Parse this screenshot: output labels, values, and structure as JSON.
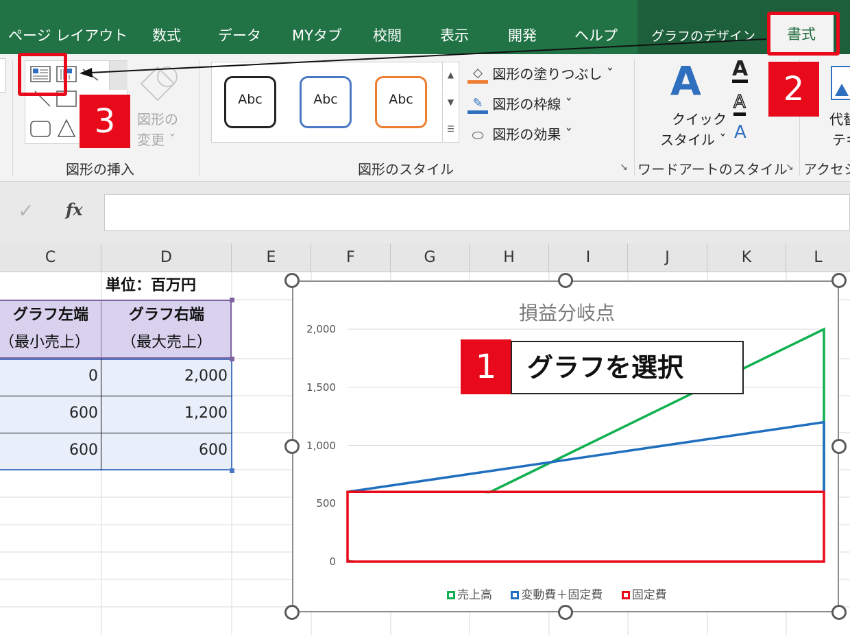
{
  "tabs": [
    "ページ レイアウト",
    "数式",
    "データ",
    "MYタブ",
    "校閲",
    "表示",
    "開発",
    "ヘルプ",
    "グラフのデザイン",
    "書式"
  ],
  "ribbon": {
    "insert_shapes_group": "図形の挿入",
    "change_shape": [
      "図形の",
      "変更 ˇ"
    ],
    "shape_styles_group": "図形のスタイル",
    "style_thumbs": [
      "Abc",
      "Abc",
      "Abc"
    ],
    "fill": "図形の塗りつぶし ˇ",
    "outline": "図形の枠線 ˇ",
    "effects": "図形の効果 ˇ",
    "quick_style": [
      "クイック",
      "スタイル ˇ"
    ],
    "wordart_group": "ワードアートのスタイル",
    "alt_text": [
      "代替",
      "テキ"
    ],
    "accessibility_group": "アクセシ"
  },
  "formula_bar": {
    "check": "✓",
    "fx": "fx",
    "value": ""
  },
  "columns": [
    "C",
    "D",
    "E",
    "F",
    "G",
    "H",
    "I",
    "J",
    "K",
    "L"
  ],
  "sheet": {
    "unit": "単位：百万円",
    "header_left": [
      "グラフ左端",
      "（最小売上）"
    ],
    "header_right": [
      "グラフ右端",
      "（最大売上）"
    ],
    "rows": [
      [
        "0",
        "2,000"
      ],
      [
        "600",
        "1,200"
      ],
      [
        "600",
        "600"
      ]
    ]
  },
  "chart_data": {
    "type": "line",
    "title": "損益分岐点",
    "x": [
      0,
      2000
    ],
    "series": [
      {
        "name": "売上高",
        "values": [
          0,
          2000
        ],
        "color": "#10b050"
      },
      {
        "name": "変動費＋固定費",
        "values": [
          600,
          1200
        ],
        "color": "#1f6fbe"
      },
      {
        "name": "固定費",
        "values": [
          600,
          600
        ],
        "color": "#e8091a"
      }
    ],
    "ylim": [
      0,
      2000
    ],
    "yticks": [
      "2,000",
      "1,500",
      "1,000",
      "500",
      "0"
    ],
    "legend_position": "bottom"
  },
  "annotations": {
    "step1_number": "1",
    "step1_text": "グラフを選択",
    "step2_number": "2",
    "step3_number": "3"
  }
}
